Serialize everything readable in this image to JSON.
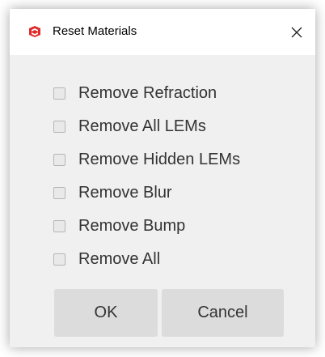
{
  "window": {
    "title": "Reset Materials",
    "icon": "sketchup-icon",
    "close_icon": "close-icon"
  },
  "options": [
    {
      "label": "Remove Refraction",
      "checked": false
    },
    {
      "label": "Remove All LEMs",
      "checked": false
    },
    {
      "label": "Remove Hidden LEMs",
      "checked": false
    },
    {
      "label": "Remove Blur",
      "checked": false
    },
    {
      "label": "Remove Bump",
      "checked": false
    },
    {
      "label": "Remove All",
      "checked": false
    }
  ],
  "buttons": {
    "ok_label": "OK",
    "cancel_label": "Cancel"
  },
  "colors": {
    "dialog_bg": "#f0f0f0",
    "titlebar_bg": "#ffffff",
    "button_bg": "#dcdcdc",
    "icon_red": "#e02a2a"
  }
}
